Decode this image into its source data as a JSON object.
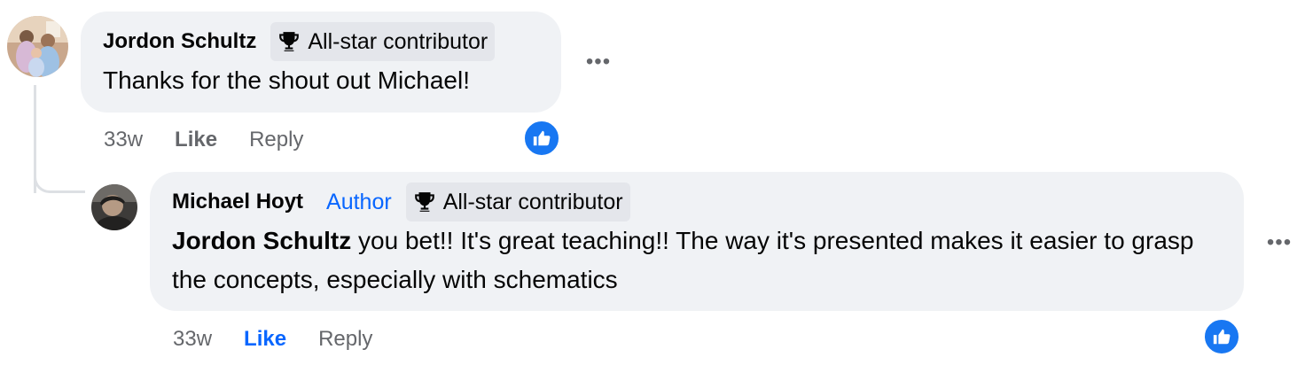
{
  "comments": [
    {
      "author": "Jordon Schultz",
      "badge": "All-star contributor",
      "text": "Thanks for the shout out Michael!",
      "time": "33w",
      "like_label": "Like",
      "reply_label": "Reply",
      "liked_by_viewer": false,
      "more_label": "•••"
    },
    {
      "author": "Michael Hoyt",
      "author_label": "Author",
      "badge": "All-star contributor",
      "mention": "Jordon Schultz",
      "text": " you bet!! It's great teaching!! The way it's presented makes it easier to grasp the concepts, especially with schematics",
      "time": "33w",
      "like_label": "Like",
      "reply_label": "Reply",
      "liked_by_viewer": true,
      "more_label": "•••"
    }
  ],
  "colors": {
    "bubble_bg": "#f0f2f5",
    "badge_bg": "#e4e6eb",
    "accent_blue": "#0866ff",
    "reaction_blue": "#1877f2",
    "secondary_text": "#65676b"
  },
  "icons": {
    "badge": "trophy-icon",
    "reaction": "like-thumb-icon",
    "more": "more-options-icon"
  }
}
